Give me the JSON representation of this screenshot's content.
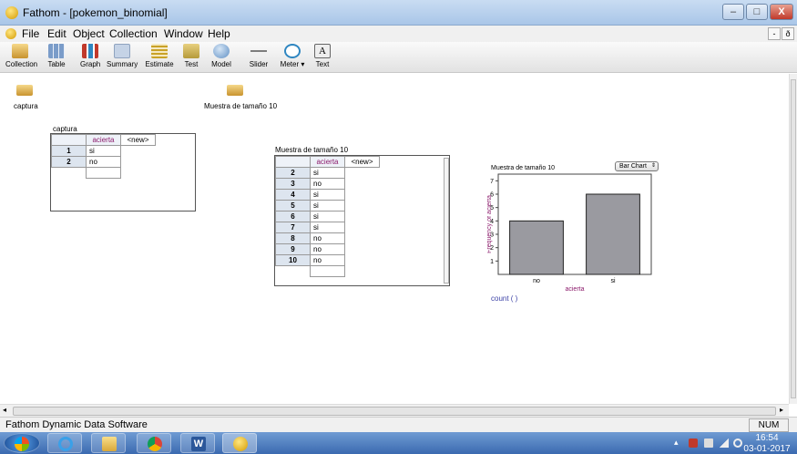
{
  "window": {
    "title": "Fathom - [pokemon_binomial]",
    "min": "–",
    "max": "□",
    "close": "X"
  },
  "menu": {
    "items": [
      "File",
      "Edit",
      "Object",
      "Collection",
      "Window",
      "Help"
    ],
    "mdi_min": "-",
    "mdi_restore": "ð"
  },
  "toolbar": {
    "items": [
      {
        "label": "Collection",
        "icon": "collection-icon",
        "color": "#d9a441"
      },
      {
        "label": "Table",
        "icon": "table-icon",
        "color": "#7a9cc9"
      },
      {
        "label": "Graph",
        "icon": "graph-icon",
        "color": "#c0392b"
      },
      {
        "label": "Summary",
        "icon": "summary-icon",
        "color": "#8fa3bf"
      },
      {
        "label": "Estimate",
        "icon": "estimate-icon",
        "color": "#c9a227"
      },
      {
        "label": "Test",
        "icon": "test-icon",
        "color": "#b59a3a"
      },
      {
        "label": "Model",
        "icon": "model-icon",
        "color": "#5f8fc4"
      },
      {
        "label": "Slider",
        "icon": "slider-icon",
        "color": "#7d7d7d"
      },
      {
        "label": "Meter ▾",
        "icon": "meter-icon",
        "color": "#2e86c1"
      },
      {
        "label": "Text",
        "icon": "text-icon",
        "color": "#eeeeee"
      }
    ]
  },
  "collections": [
    {
      "label": "captura"
    },
    {
      "label": "Muestra de tamaño 10"
    }
  ],
  "table_captura": {
    "title": "captura",
    "attr": "acierta",
    "new_col": "<new>",
    "rows": [
      {
        "n": "1",
        "v": "si"
      },
      {
        "n": "2",
        "v": "no"
      }
    ]
  },
  "table_muestra": {
    "title": "Muestra de tamaño 10",
    "attr": "acierta",
    "new_col": "<new>",
    "rows": [
      {
        "n": "2",
        "v": "si"
      },
      {
        "n": "3",
        "v": "no"
      },
      {
        "n": "4",
        "v": "si"
      },
      {
        "n": "5",
        "v": "si"
      },
      {
        "n": "6",
        "v": "si"
      },
      {
        "n": "7",
        "v": "si"
      },
      {
        "n": "8",
        "v": "no"
      },
      {
        "n": "9",
        "v": "no"
      },
      {
        "n": "10",
        "v": "no"
      }
    ]
  },
  "graph": {
    "title": "Muestra de tamaño 10",
    "chart_type_label": "Bar Chart",
    "formula": "count ( )"
  },
  "chart_data": {
    "type": "bar",
    "title": "Muestra de tamaño 10",
    "categories": [
      "no",
      "si"
    ],
    "values": [
      4,
      6
    ],
    "xlabel": "acierta",
    "ylabel": "Frequency of acierta",
    "ylim": [
      0,
      7.5
    ],
    "yticks": [
      1,
      2,
      3,
      4,
      5,
      6,
      7
    ],
    "bar_color": "#9a9aa0",
    "label_color": "#8b1a6b"
  },
  "status": {
    "text": "Fathom Dynamic Data Software",
    "num": "NUM"
  },
  "taskbar": {
    "time": "16:54",
    "date": "03-01-2017"
  }
}
